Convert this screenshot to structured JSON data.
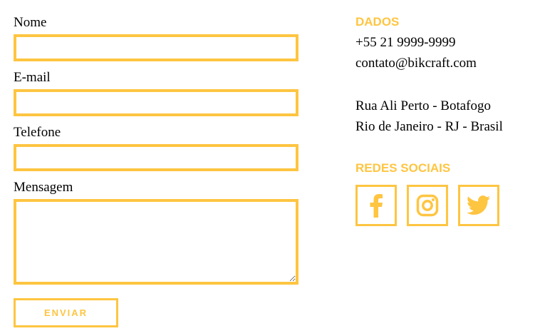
{
  "form": {
    "name_label": "Nome",
    "email_label": "E-mail",
    "phone_label": "Telefone",
    "message_label": "Mensagem",
    "name_value": "",
    "email_value": "",
    "phone_value": "",
    "message_value": "",
    "submit_label": "ENVIAR"
  },
  "contact": {
    "data_title": "DADOS",
    "phone": "+55 21 9999-9999",
    "email": "contato@bikcraft.com",
    "address_line1": "Rua Ali Perto - Botafogo",
    "address_line2": "Rio de Janeiro - RJ - Brasil"
  },
  "social": {
    "title": "REDES SOCIAIS",
    "items": [
      {
        "icon": "facebook-icon"
      },
      {
        "icon": "instagram-icon"
      },
      {
        "icon": "twitter-icon"
      }
    ]
  },
  "colors": {
    "accent": "#fec541",
    "text": "#000000",
    "background": "#ffffff"
  }
}
